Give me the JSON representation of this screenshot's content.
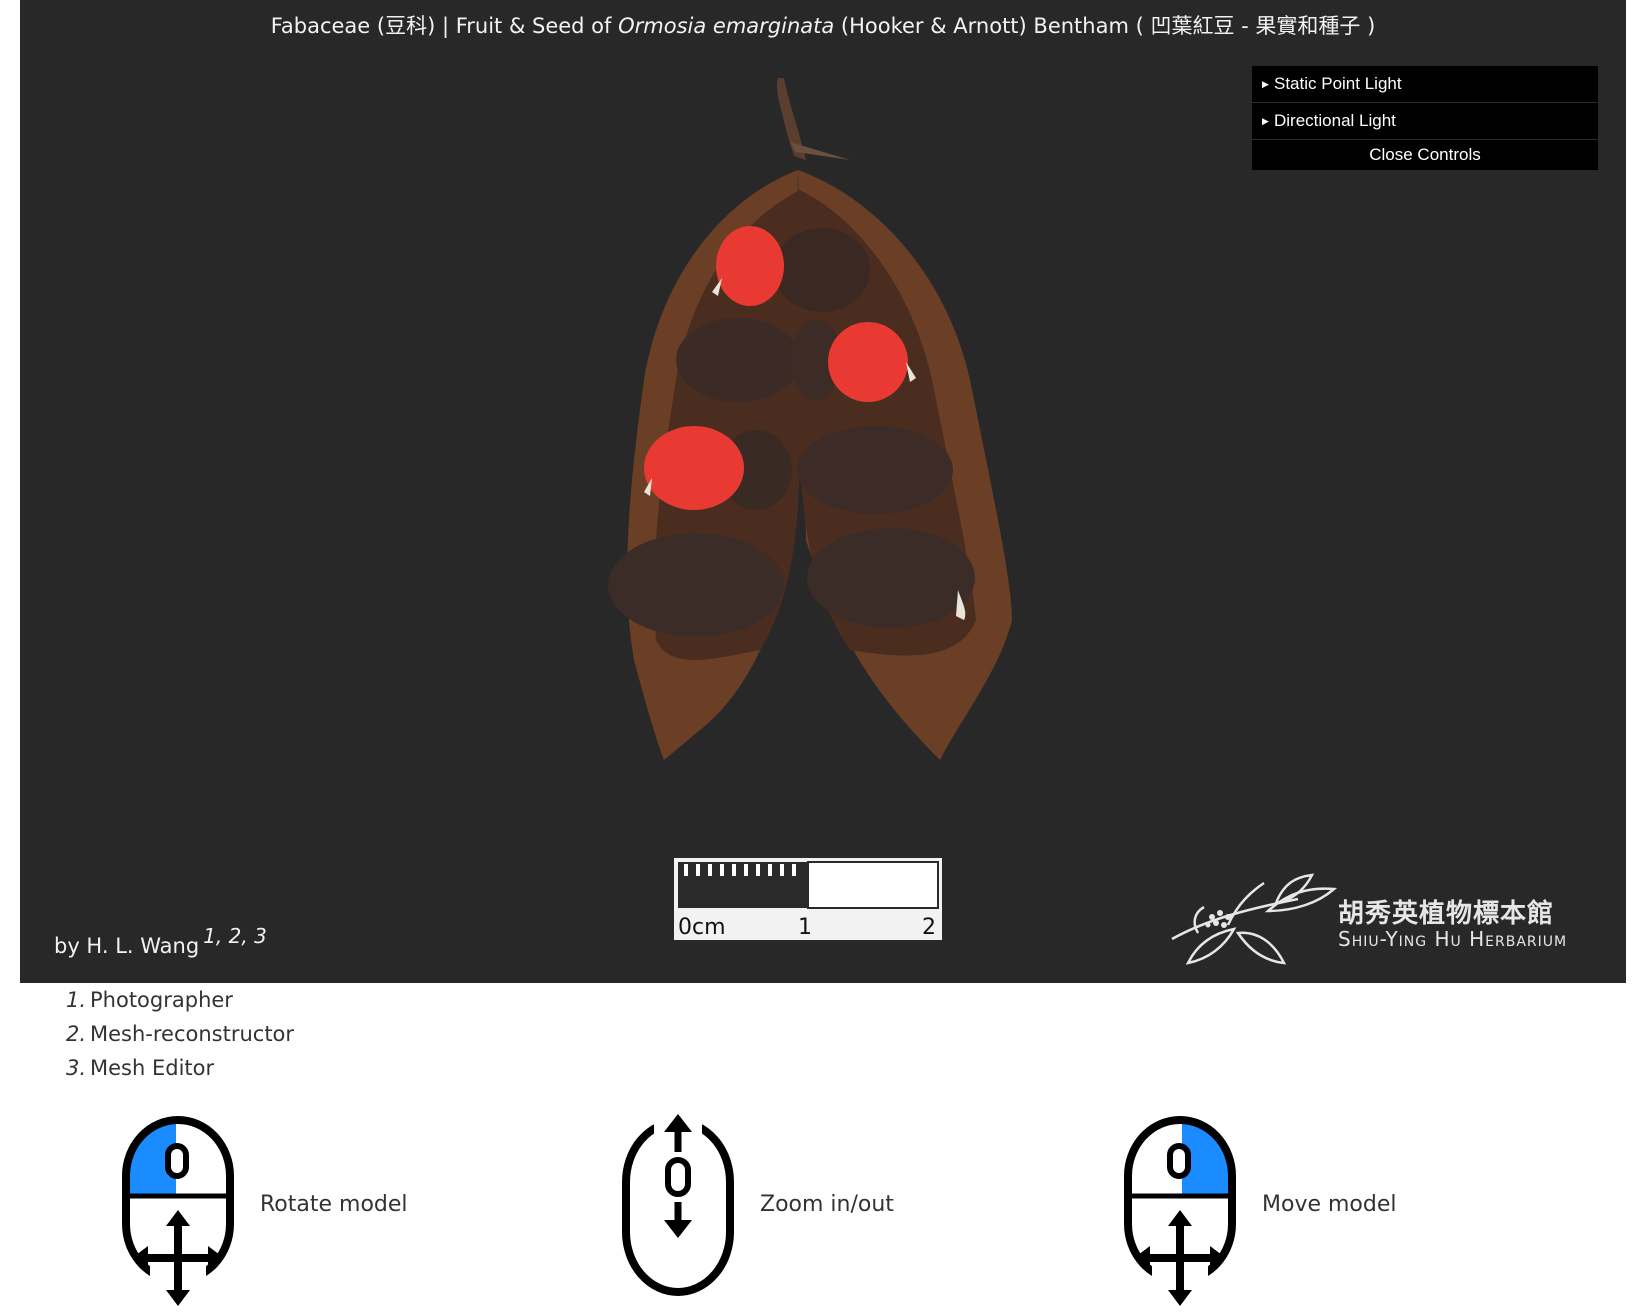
{
  "title": {
    "family": "Fabaceae (豆科)",
    "sep1": " | ",
    "prefix": "Fruit & Seed of ",
    "species": "Ormosia emarginata",
    "authority": " (Hooker & Arnott) Bentham ",
    "common": "( 凹葉紅豆 - 果實和種子 )"
  },
  "controls": {
    "items": [
      {
        "label": "Static Point Light"
      },
      {
        "label": "Directional Light"
      }
    ],
    "close_label": "Close Controls"
  },
  "scale": {
    "unit": "0cm",
    "tick1": "1",
    "tick2": "2"
  },
  "credit": {
    "by": "by H. L. Wang",
    "refs": "1, 2, 3"
  },
  "herbarium": {
    "name_cn": "胡秀英植物標本館",
    "name_en": "Shiu-Ying Hu Herbarium"
  },
  "roles": [
    {
      "num": "1.",
      "label": "Photographer"
    },
    {
      "num": "2.",
      "label": "Mesh-reconstructor"
    },
    {
      "num": "3.",
      "label": "Mesh Editor"
    }
  ],
  "help": [
    {
      "label": "Rotate model",
      "icon": "mouse-left-click-icon"
    },
    {
      "label": "Zoom in/out",
      "icon": "mouse-scroll-icon"
    },
    {
      "label": "Move model",
      "icon": "mouse-right-click-icon"
    }
  ],
  "colors": {
    "viewer_bg": "#292828",
    "controls_bg": "#000000",
    "seed_red": "#e83a32",
    "mouse_highlight": "#1a8cff"
  }
}
